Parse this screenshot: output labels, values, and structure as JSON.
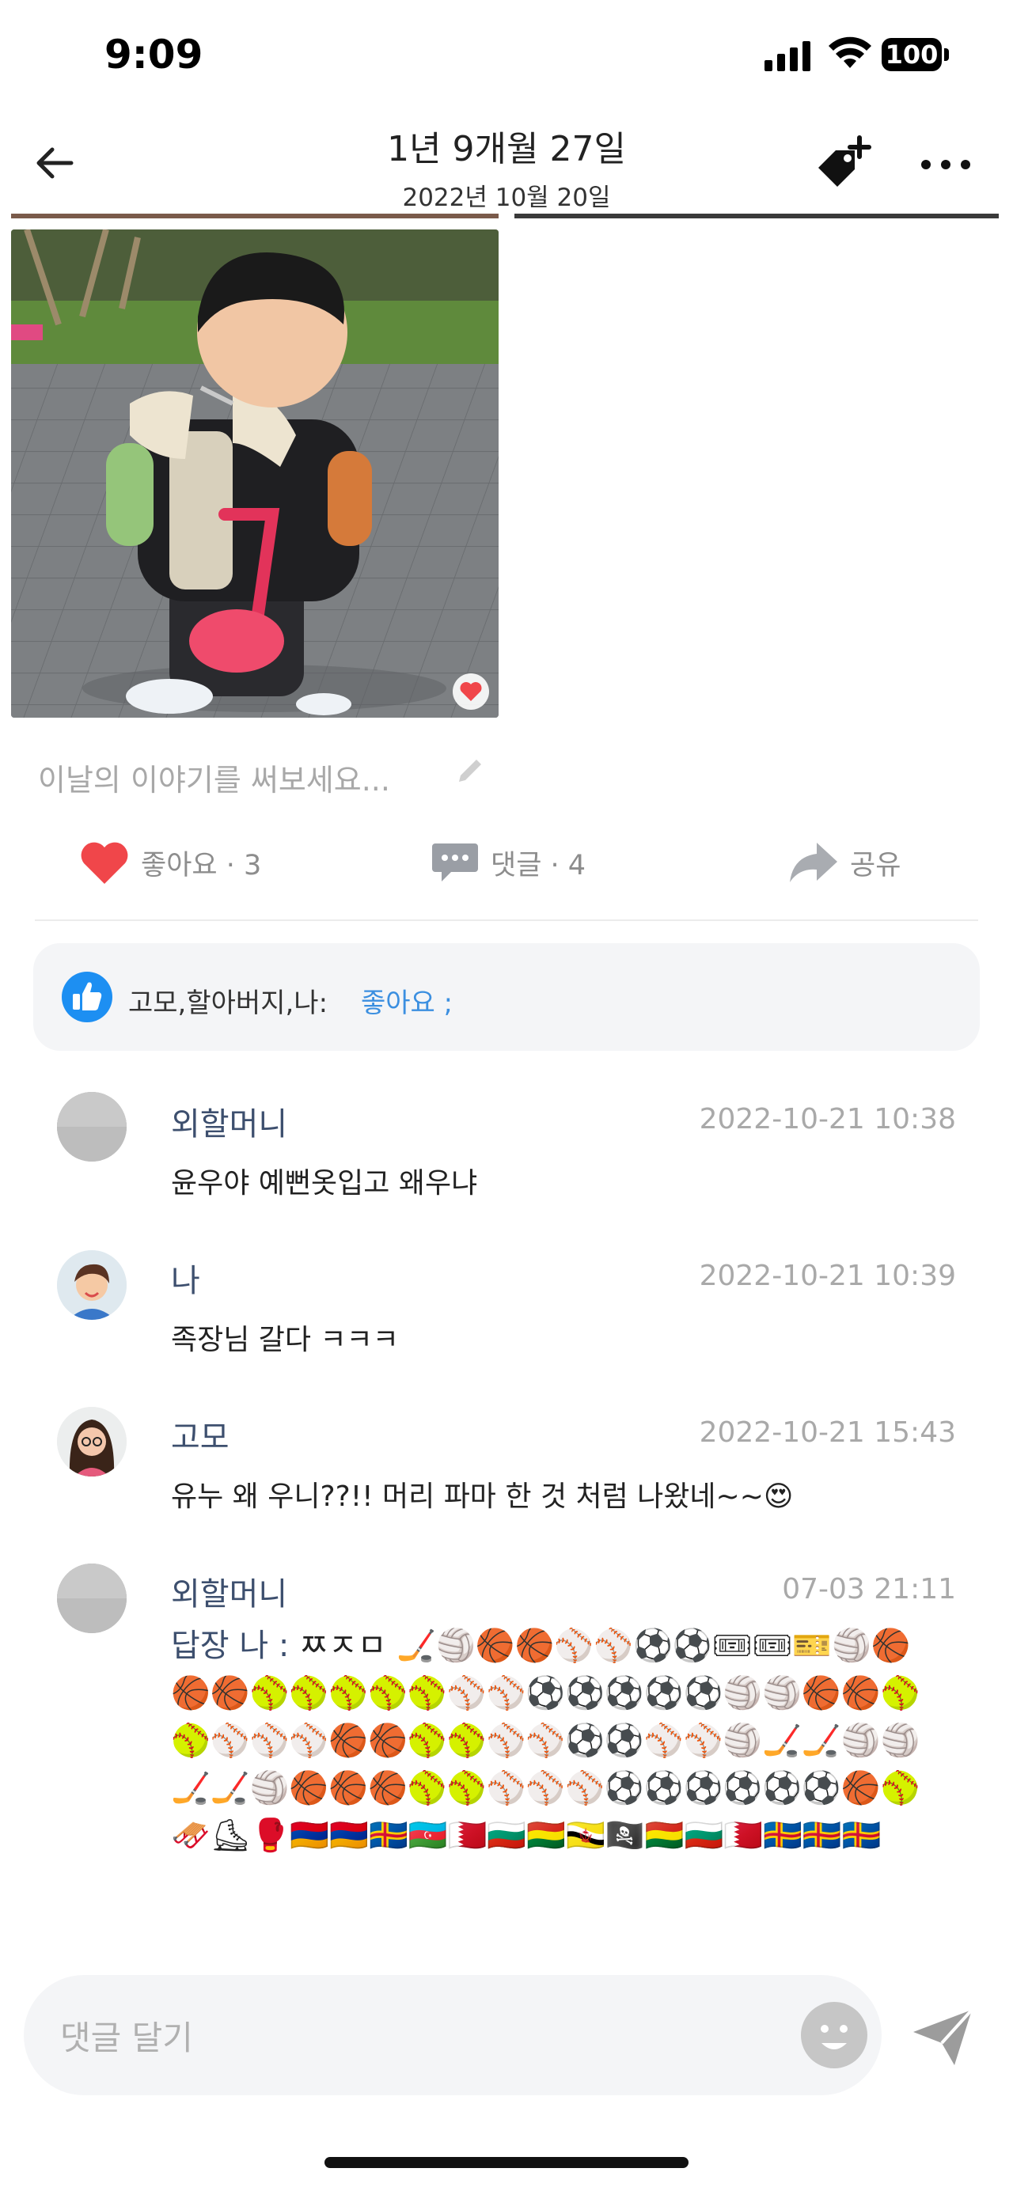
{
  "status_bar": {
    "time": "9:09",
    "battery": "100"
  },
  "header": {
    "title": "1년 9개월 27일",
    "subtitle": "2022년 10월 20일"
  },
  "story": {
    "placeholder": "이날의 이야기를 써보세요..."
  },
  "actions": {
    "like_label": "좋아요 · 3",
    "comment_label": "댓글 · 4",
    "share_label": "공유"
  },
  "likes": {
    "names": "고모,할아버지,나:",
    "label": "좋아요 ;"
  },
  "comments": [
    {
      "author": "외할머니",
      "time": "2022-10-21 10:38",
      "text": "윤우야 예뻔옷입고 왜우냐"
    },
    {
      "author": "나",
      "time": "2022-10-21 10:39",
      "text": "족장님 갈다 ㅋㅋㅋ"
    },
    {
      "author": "고모",
      "time": "2022-10-21 15:43",
      "text": "유누 왜 우니??!! 머리 파마 한 것 처럼 나왔네~~😍"
    },
    {
      "author": "외할머니",
      "time": "07-03 21:11",
      "reply_prefix": "답장 나 : ",
      "reply_text": "ㅉㅈㅁ 🏒🏐🏀🏀⚾⚾⚽⚽🎟🎟🎫🏐🏀🏀🏀🥎🥎🥎🥎🥎⚾⚾⚽⚽⚽⚽⚽🏐🏐🏀🏀🥎🥎⚾⚾⚾🏀🏀🥎🥎⚾⚾⚽⚽⚾⚾🏐🏒🏒🏐🏐🏒🏒🏐🏀🏀🏀🥎🥎⚾⚾⚾⚽⚽⚽⚽⚽⚽🏀🥎🛷⛸🥊🇦🇲🇦🇲🇦🇽🇦🇿🇧🇭🇧🇬🇧🇴🇧🇳🏴‍☠️🇧🇴🇧🇬🇧🇭🇦🇽🇦🇽🇦🇽"
    }
  ],
  "input": {
    "placeholder": "댓글 달기"
  },
  "colors": {
    "accent_blue": "#3b8fe0",
    "like_red": "#f0464a",
    "author_navy": "#3d4f6e"
  },
  "icons": {
    "back": "back-arrow-icon",
    "tag_add": "tag-plus-icon",
    "more": "more-dots-icon",
    "like": "heart-icon",
    "comment": "comment-bubble-icon",
    "share": "share-arrow-icon",
    "thumbs": "thumbs-up-icon",
    "emoji": "emoji-face-icon",
    "send": "send-icon",
    "pencil": "pencil-icon"
  }
}
